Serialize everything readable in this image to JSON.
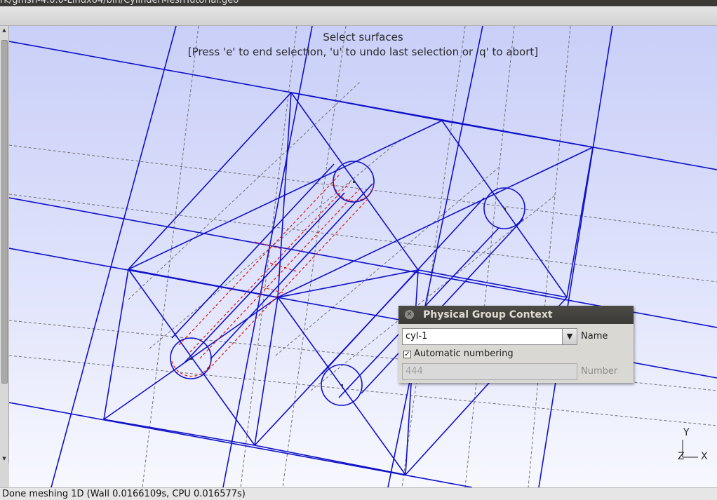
{
  "window": {
    "title": "rk/gmsh-4.0.0-Linux64/bin/CylinderMeshTutorial.geo"
  },
  "viewport": {
    "hint_line1": "Select surfaces",
    "hint_line2": "[Press 'e' to end selection, 'u' to undo last selection or 'q' to abort]",
    "axes": {
      "y": "Y",
      "z": "Z",
      "x": "X"
    },
    "colors": {
      "mesh": "#1010c8",
      "selected": "#e01818",
      "construction": "#707070"
    }
  },
  "dialog": {
    "title": "Physical Group Context",
    "name_value": "cyl-1",
    "name_label": "Name",
    "auto_numbering_label": "Automatic numbering",
    "auto_numbering_checked": true,
    "number_value": "444",
    "number_label": "Number"
  },
  "statusbar": {
    "text": "Done meshing 1D (Wall 0.0166109s, CPU 0.016577s)"
  },
  "icons": {
    "close": "close-icon",
    "dropdown": "chevron-down-icon",
    "checkmark": "checkmark-icon"
  }
}
